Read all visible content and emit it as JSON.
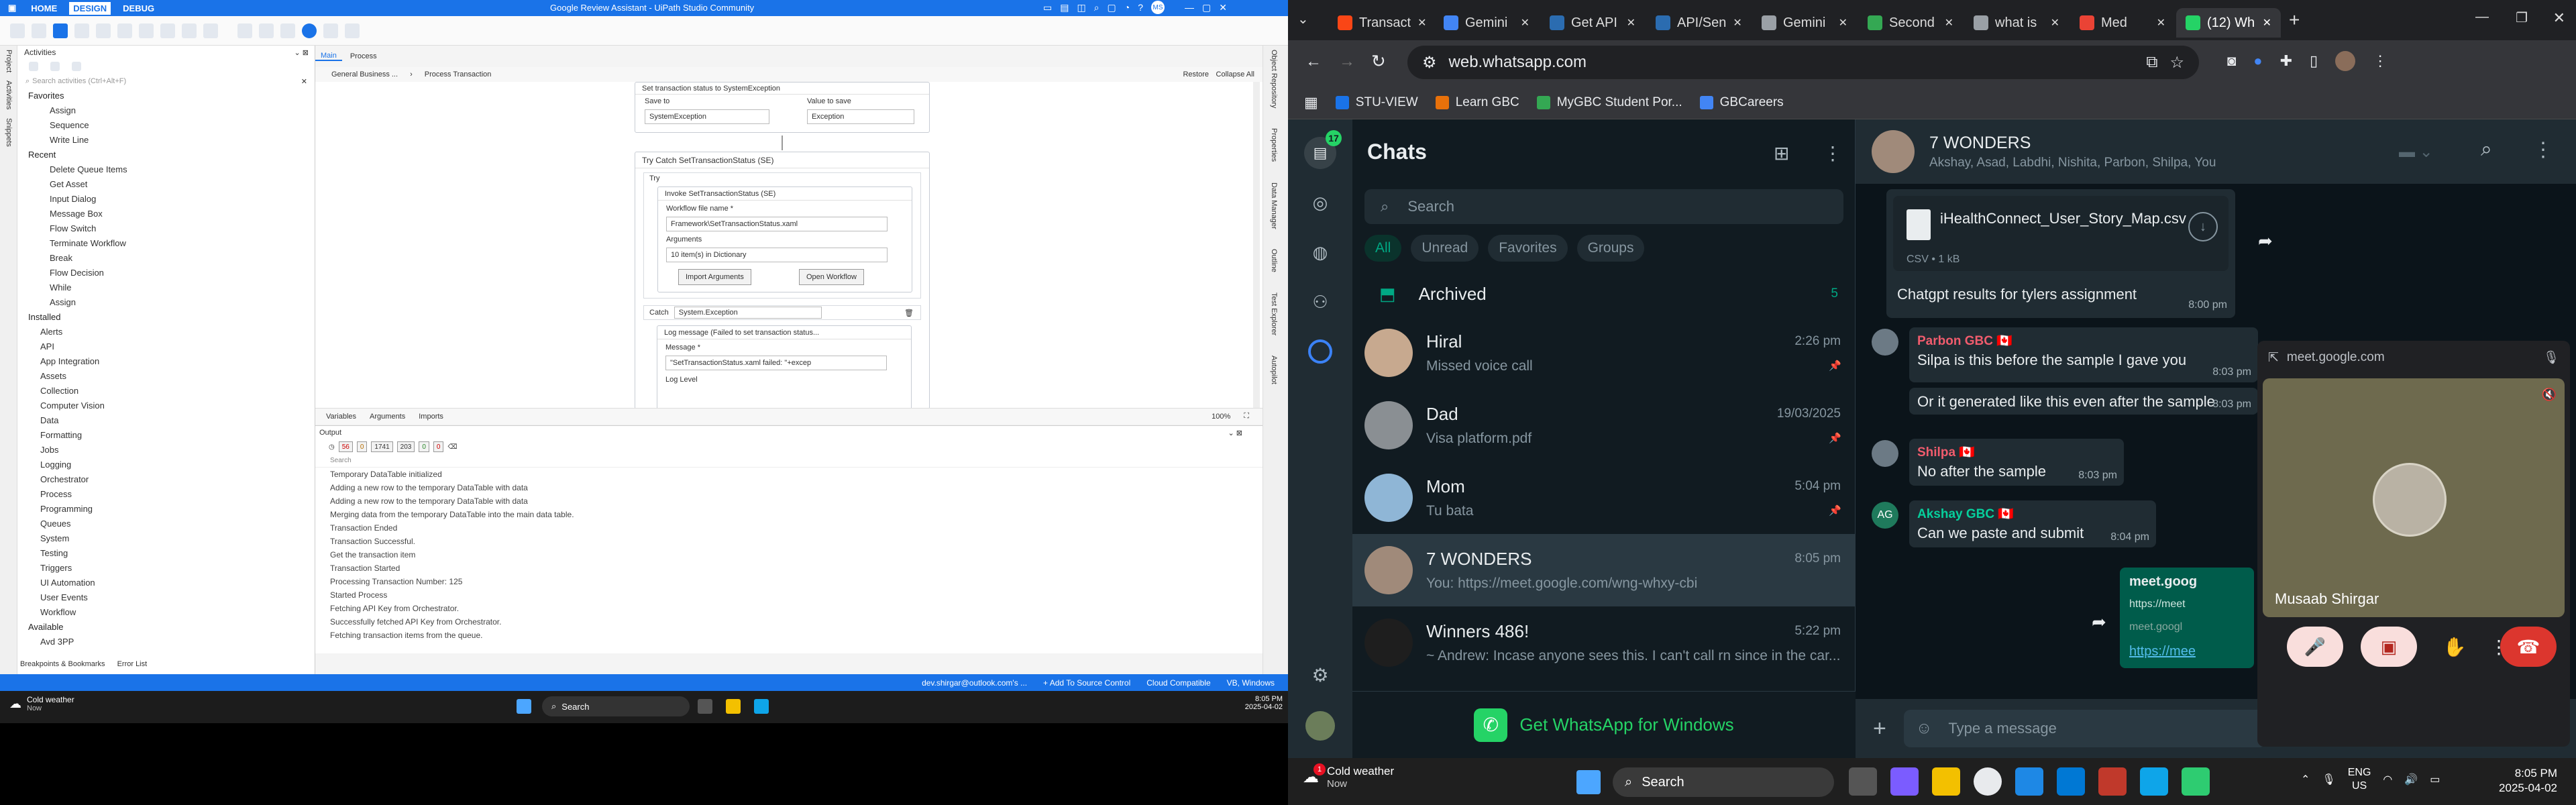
{
  "studio": {
    "window_title": "Google Review Assistant - UiPath Studio Community",
    "menu": [
      "HOME",
      "DESIGN",
      "DEBUG"
    ],
    "user_initials": "MS",
    "activities": {
      "title": "Activities",
      "search_placeholder": "Search activities (Ctrl+Alt+F)",
      "tree": [
        {
          "k": "h",
          "t": "Favorites"
        },
        {
          "k": "i",
          "t": "Assign"
        },
        {
          "k": "i",
          "t": "Sequence"
        },
        {
          "k": "i",
          "t": "Write Line"
        },
        {
          "k": "h",
          "t": "Recent"
        },
        {
          "k": "i",
          "t": "Delete Queue Items"
        },
        {
          "k": "i",
          "t": "Get Asset"
        },
        {
          "k": "i",
          "t": "Input Dialog"
        },
        {
          "k": "i",
          "t": "Message Box"
        },
        {
          "k": "i",
          "t": "Flow Switch"
        },
        {
          "k": "i",
          "t": "Terminate Workflow"
        },
        {
          "k": "i",
          "t": "Break"
        },
        {
          "k": "i",
          "t": "Flow Decision"
        },
        {
          "k": "i",
          "t": "While"
        },
        {
          "k": "i",
          "t": "Assign"
        },
        {
          "k": "h",
          "t": "Installed"
        },
        {
          "k": "c",
          "t": "Alerts"
        },
        {
          "k": "c",
          "t": "API"
        },
        {
          "k": "c",
          "t": "App Integration"
        },
        {
          "k": "c",
          "t": "Assets"
        },
        {
          "k": "c",
          "t": "Collection"
        },
        {
          "k": "c",
          "t": "Computer Vision"
        },
        {
          "k": "c",
          "t": "Data"
        },
        {
          "k": "c",
          "t": "Formatting"
        },
        {
          "k": "c",
          "t": "Jobs"
        },
        {
          "k": "c",
          "t": "Logging"
        },
        {
          "k": "c",
          "t": "Orchestrator"
        },
        {
          "k": "c",
          "t": "Process"
        },
        {
          "k": "c",
          "t": "Programming"
        },
        {
          "k": "c",
          "t": "Queues"
        },
        {
          "k": "c",
          "t": "System"
        },
        {
          "k": "c",
          "t": "Testing"
        },
        {
          "k": "c",
          "t": "Triggers"
        },
        {
          "k": "c",
          "t": "UI Automation"
        },
        {
          "k": "c",
          "t": "User Events"
        },
        {
          "k": "c",
          "t": "Workflow"
        },
        {
          "k": "h",
          "t": "Available"
        },
        {
          "k": "c",
          "t": "Avd 3PP"
        }
      ]
    },
    "doc_tabs": [
      "Main",
      "Process"
    ],
    "breadcrumb": [
      "General Business ...",
      "Process Transaction"
    ],
    "canvas_actions": [
      "Restore",
      "Collapse All"
    ],
    "assign_card": {
      "title": "Set transaction status to SystemException",
      "save_to_label": "Save to",
      "save_to_value": "SystemException",
      "value_label": "Value to save",
      "value_value": "Exception"
    },
    "try_catch": {
      "title": "Try Catch SetTransactionStatus (SE)",
      "try_label": "Try",
      "invoke_title": "Invoke SetTransactionStatus (SE)",
      "workflow_label": "Workflow file name *",
      "workflow_value": "Framework\\SetTransactionStatus.xaml",
      "arguments_label": "Arguments",
      "arguments_value": "10 item(s) in Dictionary",
      "import_button": "Import Arguments",
      "open_button": "Open Workflow",
      "catch_label": "Catch",
      "catch_value": "System.Exception",
      "log_title": "Log message (Failed to set transaction status...",
      "message_label": "Message *",
      "message_value": "\"SetTransactionStatus.xaml failed: \"+excep",
      "log_level_label": "Log Level"
    },
    "bottom_tabs": [
      "Variables",
      "Arguments",
      "Imports"
    ],
    "zoom": "100%",
    "output": {
      "title": "Output",
      "filters": [
        "56",
        "0",
        "1741",
        "203",
        "0",
        "0"
      ],
      "search_placeholder": "Search",
      "lines": [
        "Temporary DataTable initialized",
        "Adding a new row to the temporary DataTable with data",
        "Adding a new row to the temporary DataTable with data",
        "Merging data from the temporary DataTable into the main data table.",
        "Transaction Ended",
        "Transaction Successful.",
        "Get the transaction item",
        "Transaction Started",
        "Processing Transaction Number: 125",
        "Started Process",
        "Fetching API Key from Orchestrator.",
        "Successfully fetched API Key from Orchestrator.",
        "Fetching transaction items from the queue."
      ]
    },
    "panel_tabs": [
      "Breakpoints & Bookmarks",
      "Error List"
    ],
    "right_rail": [
      "Object Repository",
      "Properties",
      "Data Manager",
      "Outline",
      "Test Explorer",
      "Autopilot"
    ],
    "left_rail": [
      "Project",
      "Activities",
      "Snippets"
    ],
    "status": {
      "account": "dev.shirgar@outlook.com's ...",
      "source_control": "+ Add To Source Control",
      "compat": "Cloud Compatible",
      "vb": "VB, Windows"
    }
  },
  "taskbar_left": {
    "weather_title": "Cold weather",
    "weather_sub": "Now",
    "search_label": "Search",
    "time": "8:05 PM",
    "date": "2025-04-02"
  },
  "chrome": {
    "tabs": [
      {
        "label": "Transact",
        "color": "#fa4616"
      },
      {
        "label": "Gemini",
        "color": "#4285f4"
      },
      {
        "label": "Get API",
        "color": "#2b6cb0"
      },
      {
        "label": "API/Sen",
        "color": "#2b6cb0"
      },
      {
        "label": "Gemini",
        "color": "#9aa0a6"
      },
      {
        "label": "Second",
        "color": "#34a853"
      },
      {
        "label": "what is",
        "color": "#9aa0a6"
      },
      {
        "label": "Med",
        "color": "#ea4335"
      },
      {
        "label": "(12) Wh",
        "color": "#25d366",
        "active": true
      }
    ],
    "url": "web.whatsapp.com",
    "bookmarks": [
      "STU-VIEW",
      "Learn GBC",
      "MyGBC Student Por...",
      "GBCareers"
    ]
  },
  "whatsapp": {
    "rail_badge": "17",
    "list_title": "Chats",
    "search_placeholder": "Search",
    "filters": [
      "All",
      "Unread",
      "Favorites",
      "Groups"
    ],
    "archived_label": "Archived",
    "archived_count": "5",
    "chats": [
      {
        "name": "Hiral",
        "preview": "Missed voice call",
        "time": "2:26 pm",
        "pinned": true
      },
      {
        "name": "Dad",
        "preview": "Visa platform.pdf",
        "time": "19/03/2025",
        "pinned": true
      },
      {
        "name": "Mom",
        "preview": "Tu bata",
        "time": "5:04 pm",
        "pinned": true
      },
      {
        "name": "7 WONDERS",
        "preview": "You: https://meet.google.com/wng-whxy-cbi",
        "time": "8:05 pm",
        "pinned": false
      },
      {
        "name": "Winners 486!",
        "preview": "~ Andrew: Incase anyone sees this. I can't call rn since in the car...",
        "time": "5:22 pm",
        "pinned": false
      }
    ],
    "get_windows": "Get WhatsApp for Windows",
    "header": {
      "name": "7 WONDERS",
      "members": "Akshay, Asad, Labdhi, Nishita, Parbon, Shilpa, You"
    },
    "file": {
      "name": "iHealthConnect_User_Story_Map.csv",
      "meta": "CSV • 1 kB",
      "caption": "Chatgpt results for tylers assignment",
      "time": "8:00 pm"
    },
    "messages": [
      {
        "sender": "Parbon GBC 🇨🇦",
        "text": "Silpa is this before the sample I gave you",
        "time": "8:03 pm",
        "color": "#f15c6d"
      },
      {
        "sender": "",
        "text": "Or it generated like this even after the sample",
        "time": "8:03 pm"
      },
      {
        "sender": "Shilpa 🇨🇦",
        "text": "No after the sample",
        "time": "8:03 pm",
        "color": "#f15c6d"
      },
      {
        "sender": "Akshay GBC 🇨🇦",
        "text": "Can we paste and submit",
        "time": "8:04 pm",
        "color": "#06cf9c",
        "initials": "AG"
      }
    ],
    "outgoing": {
      "title": "meet.goog",
      "link1": "https://meet",
      "link2": "meet.googl",
      "link3": "https://mee"
    },
    "composer_placeholder": "Type a message",
    "pip": {
      "url": "meet.google.com",
      "person": "Musaab Shirgar"
    }
  },
  "taskbar_right": {
    "weather_title": "Cold weather",
    "weather_sub": "Now",
    "weather_badge": "1",
    "search_label": "Search",
    "lang": "ENG",
    "region": "US",
    "time": "8:05 PM",
    "date": "2025-04-02"
  }
}
